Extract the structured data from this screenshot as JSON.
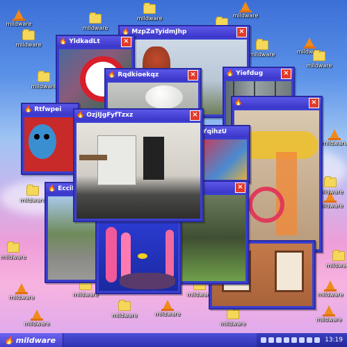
{
  "desktop": {
    "icons": [
      {
        "type": "cone",
        "label": "mildware"
      },
      {
        "type": "folder",
        "label": "mildware"
      },
      {
        "type": "folder",
        "label": "mildware"
      },
      {
        "type": "folder",
        "label": "mildware"
      },
      {
        "type": "cone",
        "label": "mildware"
      },
      {
        "type": "folder",
        "label": "mildware"
      },
      {
        "type": "folder",
        "label": "mildware"
      },
      {
        "type": "cone",
        "label": "mildware"
      },
      {
        "type": "folder",
        "label": "mildware"
      },
      {
        "type": "cone",
        "label": "mildware"
      },
      {
        "type": "folder",
        "label": "mildware"
      },
      {
        "type": "folder",
        "label": "mildware"
      },
      {
        "type": "cone",
        "label": "mildware"
      },
      {
        "type": "folder",
        "label": "mildware"
      },
      {
        "type": "cone",
        "label": "mildware"
      },
      {
        "type": "cone",
        "label": "mildware"
      },
      {
        "type": "folder",
        "label": "mildware"
      },
      {
        "type": "folder",
        "label": "mildware"
      },
      {
        "type": "cone",
        "label": "mildware"
      },
      {
        "type": "folder",
        "label": "mildware"
      },
      {
        "type": "folder",
        "label": "mildware"
      },
      {
        "type": "cone",
        "label": "mildware"
      },
      {
        "type": "folder",
        "label": "mildware"
      },
      {
        "type": "cone",
        "label": "mildware"
      },
      {
        "type": "folder",
        "label": "mildware"
      }
    ]
  },
  "windows": [
    {
      "title": "YldkadLt",
      "content": "logo"
    },
    {
      "title": "MzpZaTyidmJhp",
      "content": "tree"
    },
    {
      "title": "Rqdkioekqz",
      "content": "egg"
    },
    {
      "title": "Yiefdug",
      "content": "building"
    },
    {
      "title": "Rtfwpei",
      "content": "plush"
    },
    {
      "title": "YqihzU",
      "content": "tubes"
    },
    {
      "title": "OzjIJgFyfTzxz",
      "content": "office"
    },
    {
      "title": "EcciPw",
      "content": "street"
    },
    {
      "title": "",
      "content": "coral"
    },
    {
      "title": "",
      "content": "garden"
    },
    {
      "title": "",
      "content": "wall"
    }
  ],
  "taskbar": {
    "start_label": "mildware",
    "clock": "13:19"
  },
  "colors": {
    "titlebar": "#3b36c8",
    "close": "#e23b2a",
    "accent": "#ff9a2a"
  }
}
